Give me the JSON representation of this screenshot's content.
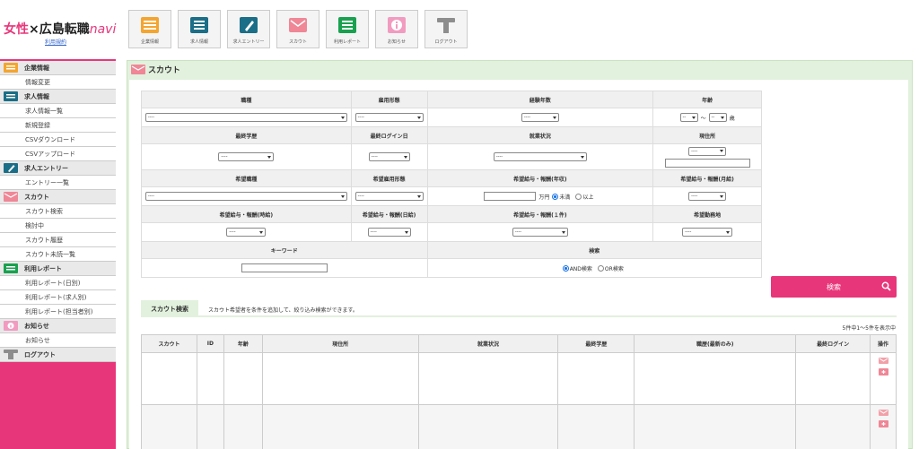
{
  "header": {
    "logo_a": "女性",
    "logo_x": "×",
    "logo_b": "広島転職",
    "logo_c": "navi",
    "terms": "利用規約"
  },
  "topnav": [
    {
      "label": "企業情報",
      "icon": "building-icon",
      "color": "#f4a52f"
    },
    {
      "label": "求人情報",
      "icon": "list-icon",
      "color": "#1b6e87"
    },
    {
      "label": "求人エントリー",
      "icon": "pen-icon",
      "color": "#1b6e87"
    },
    {
      "label": "スカウト",
      "icon": "mail-icon",
      "color": "#ef8796"
    },
    {
      "label": "利用レポート",
      "icon": "report-icon",
      "color": "#1aa150"
    },
    {
      "label": "お知らせ",
      "icon": "info-icon",
      "color": "#f29bc0"
    },
    {
      "label": "ログアウト",
      "icon": "logout-icon",
      "color": "#8d8d8d"
    }
  ],
  "sidebar": {
    "company": "企業情報",
    "company_edit": "情報変更",
    "jobs": "求人情報",
    "jobs_list": "求人情報一覧",
    "jobs_new": "新規登録",
    "jobs_csv_dl": "CSVダウンロード",
    "jobs_csv_ul": "CSVアップロード",
    "entry": "求人エントリー",
    "entry_list": "エントリー一覧",
    "scout": "スカウト",
    "scout_search": "スカウト検索",
    "scout_pending": "検討中",
    "scout_history": "スカウト履歴",
    "scout_unread": "スカウト未読一覧",
    "report": "利用レポート",
    "report_daily": "利用レポート(日別)",
    "report_job": "利用レポート(求人別)",
    "report_staff": "利用レポート(担当者別)",
    "news": "お知らせ",
    "news_item": "お知らせ",
    "logout": "ログアウト"
  },
  "main": {
    "title": "スカウト"
  },
  "form": {
    "h_job": "職種",
    "h_emp": "雇用形態",
    "h_exp": "経験年数",
    "h_age": "年齢",
    "h_edu": "最終学歴",
    "h_login": "最終ログイン日",
    "h_status": "就業状況",
    "h_addr": "現住所",
    "h_wjob": "希望職種",
    "h_wemp": "希望雇用形態",
    "h_wsal_y": "希望給与・報酬(年収)",
    "h_wsal_m": "希望給与・報酬(月給)",
    "h_wsal_h": "希望給与・報酬(時給)",
    "h_wsal_d": "希望給与・報酬(日給)",
    "h_wsal_c": "希望給与・報酬(１件)",
    "h_wloc": "希望勤務地",
    "h_kw": "キーワード",
    "h_search": "検索",
    "sel": "----",
    "sel_short": "--",
    "tilde": "～",
    "age_unit": "歳",
    "man_yen": "万円",
    "under": "未満",
    "over": "以上",
    "and": "AND検索",
    "or": "OR検索"
  },
  "search_button": "検索",
  "results": {
    "tab": "スカウト検索",
    "desc": "スカウト希望者を条件を追加して、絞り込み検索ができます。",
    "count": "5件中1～5件を表示中",
    "cols": [
      "スカウト",
      "ID",
      "年齢",
      "現住所",
      "就業状況",
      "最終学歴",
      "職歴(最新のみ)",
      "最終ログイン",
      "操作"
    ]
  },
  "colors": {
    "accent": "#e8367a",
    "green_bg": "#e2f1dd"
  }
}
